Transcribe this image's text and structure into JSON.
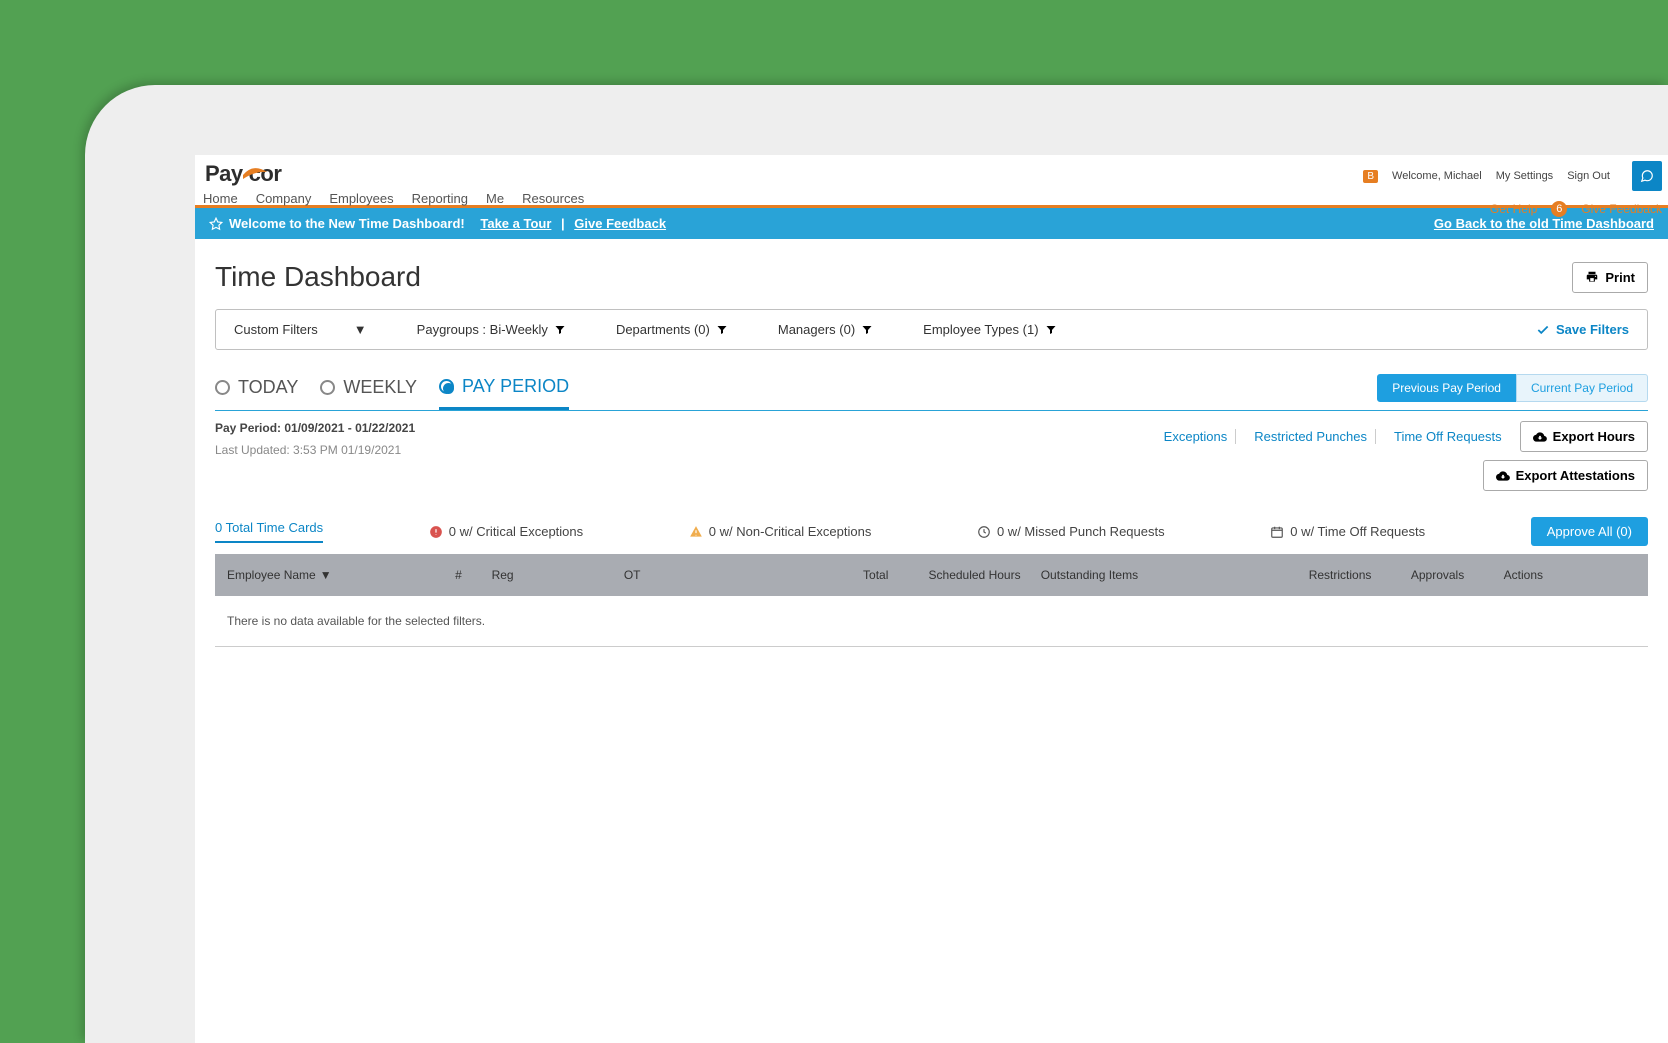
{
  "brand": "Paycor",
  "nav": [
    "Home",
    "Company",
    "Employees",
    "Reporting",
    "Me",
    "Resources"
  ],
  "header": {
    "welcome_badge": "B",
    "welcome": "Welcome, Michael",
    "my_settings": "My Settings",
    "sign_out": "Sign Out",
    "get_help": "Get Help",
    "help_count": "6",
    "give_feedback": "Give Feedback"
  },
  "banner": {
    "text": "Welcome to the New Time Dashboard!",
    "tour": "Take a Tour",
    "feedback": "Give Feedback",
    "go_back": "Go Back to the old Time Dashboard"
  },
  "page_title": "Time Dashboard",
  "print": "Print",
  "filters": {
    "custom": "Custom Filters",
    "paygroups": "Paygroups : Bi-Weekly",
    "departments": "Departments (0)",
    "managers": "Managers (0)",
    "employee_types": "Employee Types (1)",
    "save": "Save Filters"
  },
  "view_tabs": {
    "today": "TODAY",
    "weekly": "WEEKLY",
    "pay_period": "PAY PERIOD",
    "selected": "pay_period"
  },
  "period_buttons": {
    "previous": "Previous Pay Period",
    "current": "Current Pay Period"
  },
  "pay_period_label": "Pay Period: 01/09/2021 - 01/22/2021",
  "last_updated": "Last Updated: 3:53 PM 01/19/2021",
  "links": {
    "exceptions": "Exceptions",
    "restricted": "Restricted Punches",
    "time_off": "Time Off Requests",
    "export_hours": "Export Hours",
    "export_attest": "Export Attestations"
  },
  "stats": {
    "total": "0 Total Time Cards",
    "critical": "0 w/ Critical Exceptions",
    "noncritical": "0 w/ Non-Critical Exceptions",
    "missed": "0 w/ Missed Punch Requests",
    "timeoff": "0 w/ Time Off Requests",
    "approve": "Approve All (0)"
  },
  "columns": {
    "name": "Employee Name",
    "num": "#",
    "reg": "Reg",
    "ot": "OT",
    "total": "Total",
    "scheduled": "Scheduled Hours",
    "outstanding": "Outstanding Items",
    "restrictions": "Restrictions",
    "approvals": "Approvals",
    "actions": "Actions"
  },
  "no_data": "There is no data available for the selected filters."
}
